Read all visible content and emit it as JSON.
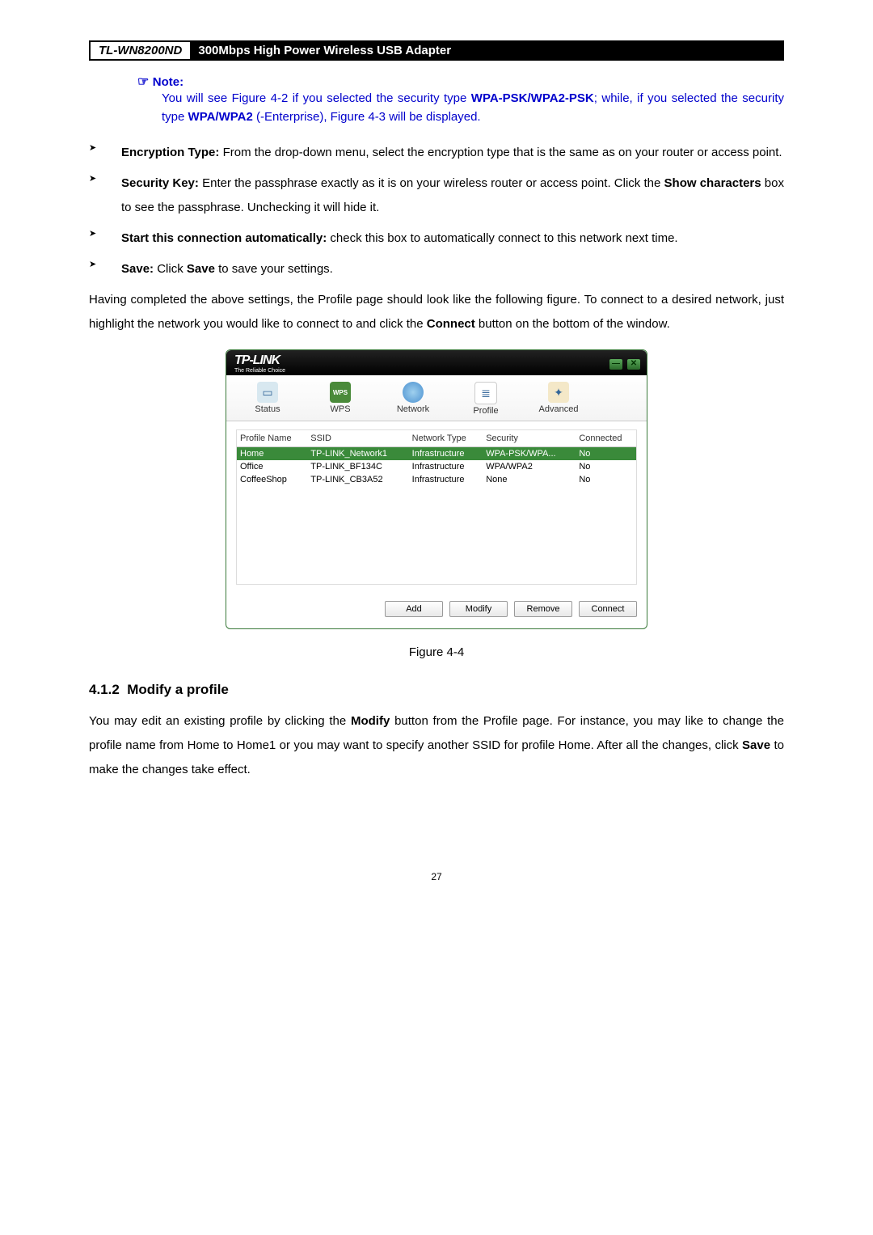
{
  "header": {
    "model": "TL-WN8200ND",
    "desc": "300Mbps High Power Wireless USB Adapter"
  },
  "note": {
    "label": "Note:",
    "line1_a": "You will see Figure 4-2 if you selected the security type ",
    "bold1": "WPA-PSK/WPA2-PSK",
    "line1_b": "; while, if you selected the security type ",
    "bold2": "WPA/WPA2",
    "line1_c": " (-Enterprise), Figure 4-3 will be displayed."
  },
  "bullets": [
    {
      "bold": "Encryption Type:",
      "text": " From the drop-down menu, select the encryption type that is the same as on your router or access point."
    },
    {
      "bold": "Security Key:",
      "text": " Enter the passphrase exactly as it is on your wireless router or access point. Click the ",
      "bold2": "Show characters",
      "text2": " box to see the passphrase. Unchecking it will hide it."
    },
    {
      "bold": "Start this connection automatically:",
      "text": " check this box to automatically connect to this network next time."
    },
    {
      "bold": "Save:",
      "text": " Click ",
      "bold2": "Save",
      "text2": " to save your settings."
    }
  ],
  "para1_a": "Having completed the above settings, the Profile page should look like the following figure. To connect to a desired network, just highlight the network you would like to connect to and click the ",
  "para1_bold": "Connect",
  "para1_b": " button on the bottom of the window.",
  "app": {
    "brand": "TP-LINK",
    "tagline": "The Reliable Choice",
    "tabs": {
      "status": "Status",
      "wps": "WPS",
      "network": "Network",
      "profile": "Profile",
      "advanced": "Advanced"
    },
    "columns": [
      "Profile Name",
      "SSID",
      "Network Type",
      "Security",
      "Connected"
    ],
    "rows": [
      {
        "name": "Home",
        "ssid": "TP-LINK_Network1",
        "type": "Infrastructure",
        "sec": "WPA-PSK/WPA...",
        "conn": "No",
        "selected": true
      },
      {
        "name": "Office",
        "ssid": "TP-LINK_BF134C",
        "type": "Infrastructure",
        "sec": "WPA/WPA2",
        "conn": "No",
        "selected": false
      },
      {
        "name": "CoffeeShop",
        "ssid": "TP-LINK_CB3A52",
        "type": "Infrastructure",
        "sec": "None",
        "conn": "No",
        "selected": false
      }
    ],
    "buttons": {
      "add": "Add",
      "modify": "Modify",
      "remove": "Remove",
      "connect": "Connect"
    }
  },
  "figure_caption": "Figure 4-4",
  "section": {
    "num": "4.1.2",
    "title": "Modify a profile"
  },
  "para2_a": "You may edit an existing profile by clicking the ",
  "para2_bold1": "Modify",
  "para2_b": " button from the Profile page. For instance, you may like to change the profile name from Home to Home1 or you may want to specify another SSID for profile Home. After all the changes, click ",
  "para2_bold2": "Save",
  "para2_c": " to make the changes take effect.",
  "page_num": "27"
}
